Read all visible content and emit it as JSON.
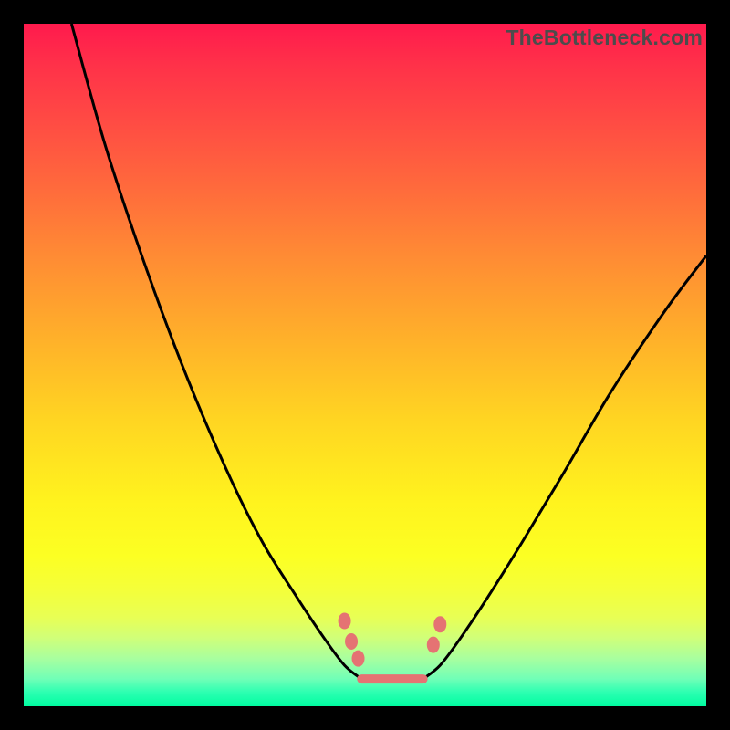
{
  "watermark": "TheBottleneck.com",
  "chart_data": {
    "type": "line",
    "title": "",
    "xlabel": "",
    "ylabel": "",
    "xlim": [
      0,
      100
    ],
    "ylim": [
      0,
      100
    ],
    "grid": false,
    "legend": false,
    "series": [
      {
        "name": "left-curve",
        "x": [
          7,
          12,
          18,
          24,
          30,
          35,
          40,
          44,
          47,
          49.5
        ],
        "values": [
          100,
          82,
          64,
          48,
          34,
          24,
          16,
          10,
          6,
          4
        ]
      },
      {
        "name": "right-curve",
        "x": [
          58.5,
          61,
          64,
          68,
          73,
          79,
          86,
          94,
          100
        ],
        "values": [
          4,
          6,
          10,
          16,
          24,
          34,
          46,
          58,
          66
        ]
      },
      {
        "name": "bottom-flat",
        "x": [
          49.5,
          58.5
        ],
        "values": [
          4,
          4
        ]
      }
    ],
    "markers": [
      {
        "x": 47.0,
        "y": 12.5
      },
      {
        "x": 48.0,
        "y": 9.5
      },
      {
        "x": 49.0,
        "y": 7.0
      },
      {
        "x": 60.0,
        "y": 9.0
      },
      {
        "x": 61.0,
        "y": 12.0
      }
    ],
    "marker_color": "#e57373",
    "curve_color": "#000000",
    "background_gradient": {
      "top": "#ff1a4d",
      "mid": "#ffd522",
      "bottom": "#00fca0"
    }
  }
}
